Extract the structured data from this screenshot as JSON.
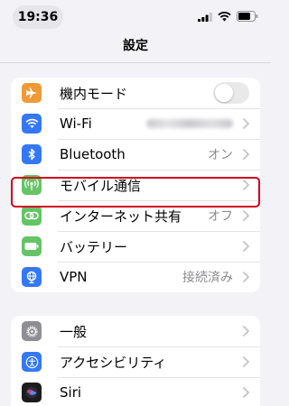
{
  "status_bar": {
    "time": "19:36"
  },
  "nav": {
    "title": "設定"
  },
  "groups": [
    {
      "rows": [
        {
          "id": "airplane",
          "label": "機内モード",
          "icon": "airplane-icon",
          "color": "#f09a37",
          "toggle": "off"
        },
        {
          "id": "wifi",
          "label": "Wi-Fi",
          "icon": "wifi-icon",
          "color": "#3478f6",
          "value": "",
          "value_obscured": true
        },
        {
          "id": "bluetooth",
          "label": "Bluetooth",
          "icon": "bluetooth-icon",
          "color": "#3478f6",
          "value": "オン"
        },
        {
          "id": "cellular",
          "label": "モバイル通信",
          "icon": "antenna-icon",
          "color": "#65c466"
        },
        {
          "id": "hotspot",
          "label": "インターネット共有",
          "icon": "link-icon",
          "color": "#65c466",
          "value": "オフ",
          "highlighted": true
        },
        {
          "id": "battery",
          "label": "バッテリー",
          "icon": "battery-icon",
          "color": "#65c466"
        },
        {
          "id": "vpn",
          "label": "VPN",
          "icon": "globe-icon",
          "color": "#3478f6",
          "value": "接続済み"
        }
      ]
    },
    {
      "rows": [
        {
          "id": "general",
          "label": "一般",
          "icon": "gear-icon",
          "color": "#8e8e93"
        },
        {
          "id": "accessibility",
          "label": "アクセシビリティ",
          "icon": "accessibility-icon",
          "color": "#3478f6"
        },
        {
          "id": "siri",
          "label": "Siri",
          "icon": "siri-icon",
          "color": "#1c1c1e"
        }
      ]
    }
  ],
  "highlight_color": "#d0021b"
}
